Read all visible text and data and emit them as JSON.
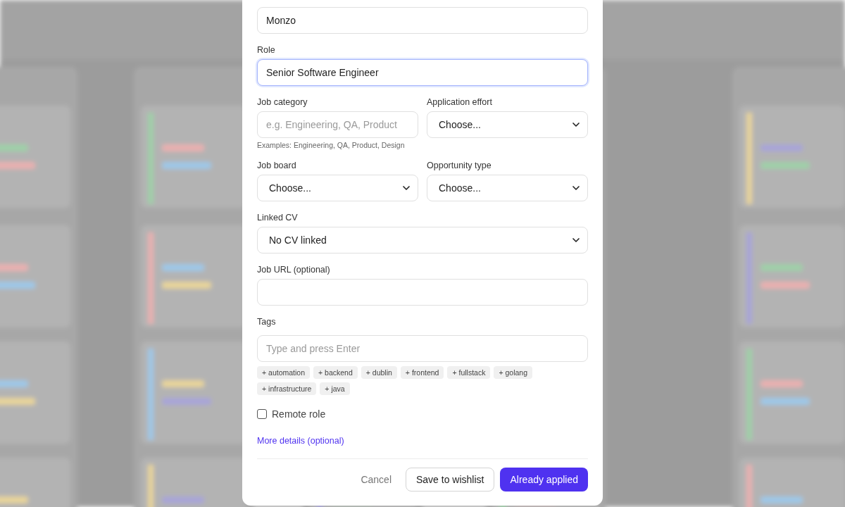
{
  "dialog": {
    "rows": [
      [
        {
          "kind": "text",
          "value": "Monzo",
          "focused": false
        }
      ],
      [
        {
          "kind": "text",
          "label": "Role",
          "value": "Senior Software Engineer",
          "focused": true
        }
      ],
      [
        {
          "kind": "text",
          "label": "Job category",
          "placeholder": "e.g. Engineering, QA, Product",
          "hint": "Examples: Engineering, QA, Product, Design",
          "focused": false
        },
        {
          "kind": "select",
          "label": "Application effort",
          "value": "Choose...",
          "focused": false
        }
      ],
      [
        {
          "kind": "select",
          "label": "Job board",
          "value": "Choose...",
          "focused": false
        },
        {
          "kind": "select",
          "label": "Opportunity type",
          "value": "Choose...",
          "focused": false
        }
      ],
      [
        {
          "kind": "select",
          "label": "Linked CV",
          "value": "No CV linked",
          "focused": false
        }
      ],
      [
        {
          "kind": "text",
          "label": "Job URL (optional)",
          "focused": false
        }
      ]
    ],
    "tags": {
      "label": "Tags",
      "placeholder": "Type and press Enter",
      "suggestions": [
        "+ automation",
        "+ backend",
        "+ dublin",
        "+ frontend",
        "+ fullstack",
        "+ golang",
        "+ infrastructure",
        "+ java"
      ]
    },
    "remote": {
      "label": "Remote role",
      "checked": false
    },
    "more_link": "More details (optional)",
    "buttons": [
      {
        "kind": "ghost",
        "label": "Cancel"
      },
      {
        "kind": "outline",
        "label": "Save to wishlist"
      },
      {
        "kind": "primary",
        "label": "Already applied"
      }
    ]
  }
}
